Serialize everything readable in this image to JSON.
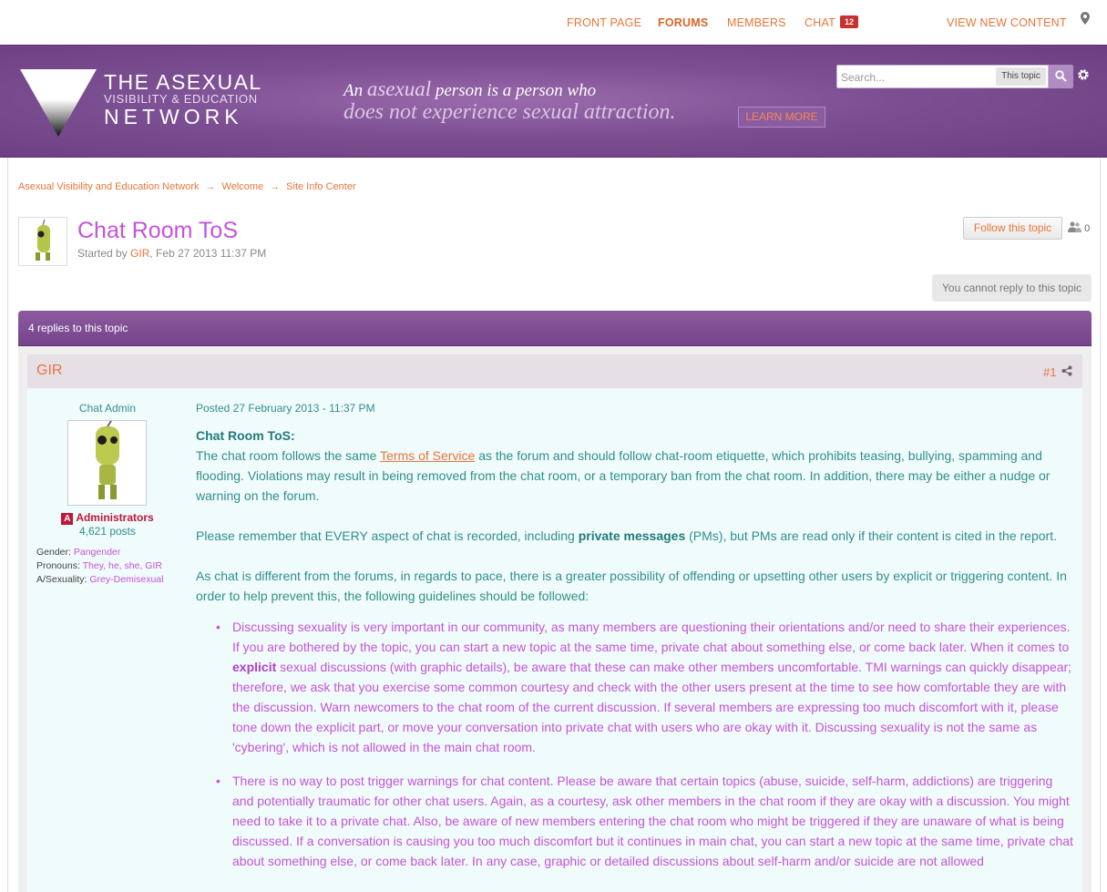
{
  "nav": {
    "items": [
      "FRONT PAGE",
      "FORUMS",
      "MEMBERS",
      "CHAT"
    ],
    "chat_count": "12",
    "view_new": "VIEW NEW CONTENT"
  },
  "banner": {
    "logo_line1": "THE  ASEXUAL",
    "logo_line2": "VISIBILITY & EDUCATION",
    "logo_line3": "NETWORK",
    "tag_an": "An",
    "tag_asexual": "asexual",
    "tag_rest": "person is a person who",
    "tag_line2": "does not experience sexual attraction.",
    "learn_more": "LEARN MORE"
  },
  "search": {
    "placeholder": "Search...",
    "scope": "This topic"
  },
  "breadcrumb": [
    "Asexual Visibility and Education Network",
    "Welcome",
    "Site Info Center"
  ],
  "topic": {
    "title": "Chat Room ToS",
    "started_by": "Started by",
    "author": "GIR",
    "date": ", Feb 27 2013 11:37 PM",
    "follow_label": "Follow this topic",
    "followers": "0",
    "cannot_reply": "You cannot reply to this topic",
    "replies": "4 replies to this topic"
  },
  "post": {
    "author": "GIR",
    "number": "#1",
    "member_title": "Chat Admin",
    "group_badge": "A",
    "group": "Administrators",
    "post_count": "4,621 posts",
    "fields": [
      {
        "label": "Gender:",
        "value": "Pangender"
      },
      {
        "label": "Pronouns:",
        "value": "They, he, she, GIR"
      },
      {
        "label": "A/Sexuality:",
        "value": "Grey-Demisexual"
      }
    ],
    "posted": "Posted 27 February 2013 - 11:37 PM",
    "heading": "Chat Room ToS:",
    "p1_a": "The chat room follows the same ",
    "p1_link": "Terms of Service",
    "p1_b": " as the forum and should follow chat-room etiquette, which prohibits teasing, bullying, spamming and flooding. Violations may result in being removed from the chat room, or a temporary ban from the chat room. In addition, there may be either a nudge or warning on the forum.",
    "p2_a": "Please remember that EVERY aspect of chat is recorded, including ",
    "p2_bold": "private messages",
    "p2_b": " (PMs), but PMs are read only if their content is cited in the report.",
    "p3": "As chat is different from the forums, in regards to pace, there is a greater possibility of offending or upsetting other users by explicit or triggering content. In order to help prevent this, the following guidelines should be followed:",
    "li1_a": "Discussing sexuality is very important in our community, as many members are questioning their orientations and/or need to share their experiences. If you are bothered by the topic, you can start a new topic at the same time, private chat about something else, or come back later. When it comes to ",
    "li1_bold": "explicit",
    "li1_b": " sexual discussions (with graphic details), be aware that these can make other members uncomfortable. TMI warnings can quickly disappear; therefore, we ask that you exercise some common courtesy and check with the other users present at the time to see how comfortable they are with the discussion. Warn newcomers to the chat room of the current discussion. If several members are expressing too much discomfort with it, please tone down the explicit part, or move your conversation into private chat with users who are okay with it. Discussing sexuality is not the same as 'cybering', which is not allowed in the main chat room.",
    "li2": "There is no way to post trigger warnings for chat content. Please be aware that certain topics (abuse, suicide, self-harm, addictions) are triggering and potentially traumatic for other chat users. Again, as a courtesy, ask other members in the chat room if they are okay with a discussion. You might need to take it to a private chat. Also, be aware of new members entering the chat room who might be triggered if they are unaware of what is being discussed. If a conversation is causing you too much discomfort but it continues in main chat, you can start a new topic at the same time, private chat about something else, or come back later. In any case, graphic or detailed discussions about self-harm and/or suicide are not allowed"
  }
}
